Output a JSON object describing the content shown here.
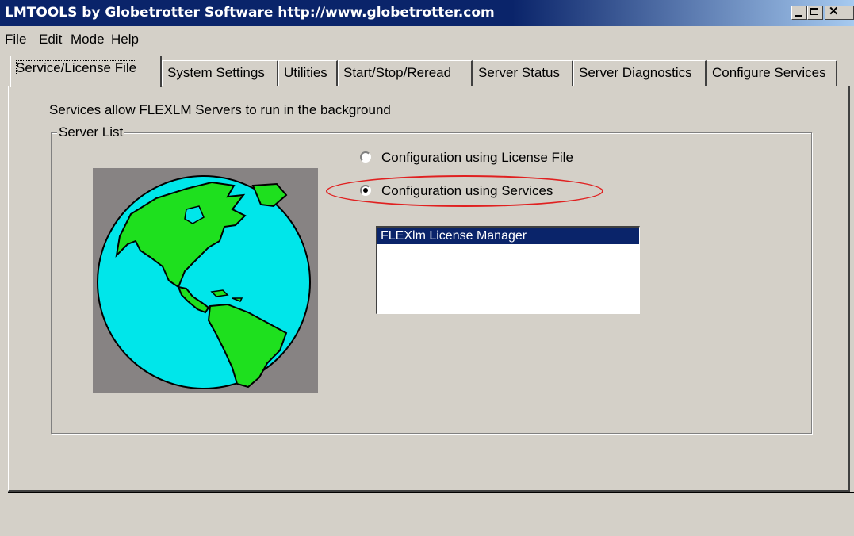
{
  "window": {
    "title": "LMTOOLS by Globetrotter Software http://www.globetrotter.com",
    "controls": [
      "minimize",
      "maximize",
      "close"
    ]
  },
  "menu": {
    "items": [
      "File",
      "Edit",
      "Mode",
      "Help"
    ]
  },
  "tabs": [
    {
      "label": "Service/License File",
      "active": true
    },
    {
      "label": "System Settings",
      "active": false
    },
    {
      "label": "Utilities",
      "active": false
    },
    {
      "label": "Start/Stop/Reread",
      "active": false
    },
    {
      "label": "Server Status",
      "active": false
    },
    {
      "label": "Server Diagnostics",
      "active": false
    },
    {
      "label": "Configure Services",
      "active": false
    }
  ],
  "page": {
    "intro": "Services allow FLEXLM Servers to run in the background",
    "group_label": "Server List",
    "radio_license_file": "Configuration using License File",
    "radio_services": "Configuration using Services",
    "selected_option": "Configuration using Services",
    "services_list": [
      "FLEXlm License Manager"
    ],
    "selected_service": "FLEXlm License Manager",
    "highlight_color": "#e02020"
  },
  "colors": {
    "titlebar": "#0a246a",
    "face": "#d4d0c8",
    "selection": "#0a246a",
    "globe_ocean": "#00e6ea",
    "globe_land": "#1ee01e",
    "globe_bg": "#878383"
  }
}
